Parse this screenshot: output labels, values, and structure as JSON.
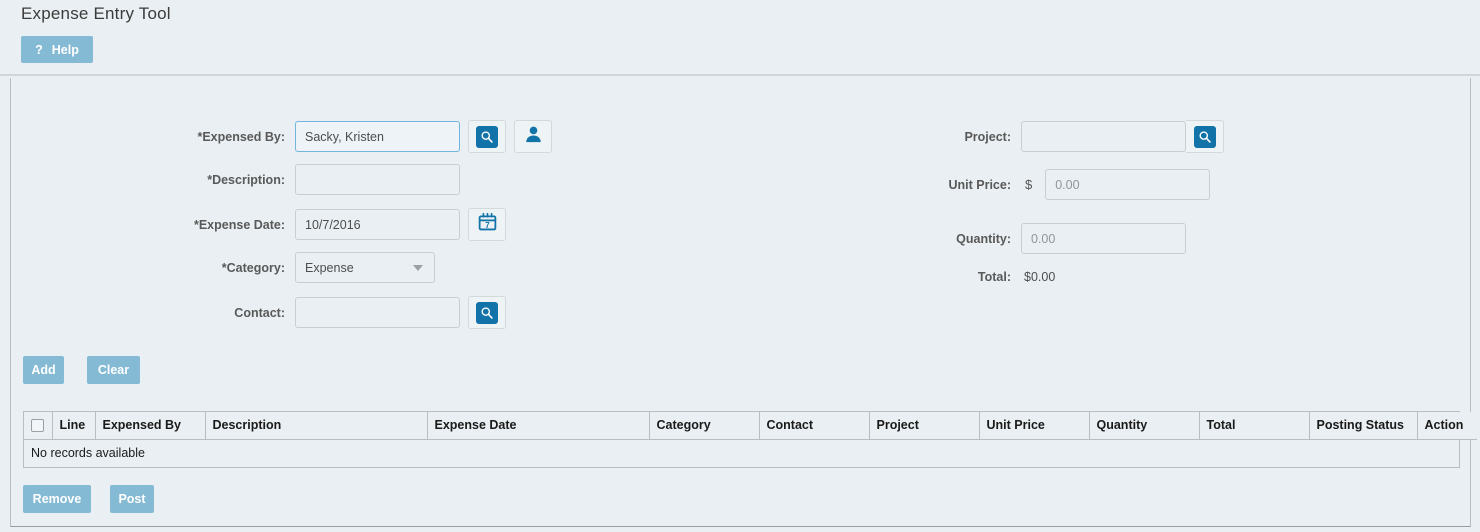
{
  "header": {
    "title": "Expense Entry Tool",
    "help_button": {
      "icon": "question-mark-icon",
      "symbol": "?",
      "label": "Help"
    }
  },
  "form": {
    "left": [
      {
        "label": "*Expensed By:",
        "value": "Sacky, Kristen",
        "placeholder": "",
        "type": "text",
        "focused": true,
        "buttons": [
          {
            "icon": "search-icon",
            "boxed": true
          },
          {
            "icon": "person-icon",
            "boxed": false
          }
        ]
      },
      {
        "label": "*Description:",
        "value": "",
        "placeholder": "",
        "type": "text",
        "focused": false,
        "buttons": []
      },
      {
        "label": "*Expense Date:",
        "value": "10/7/2016",
        "placeholder": "",
        "type": "text",
        "focused": false,
        "buttons": [
          {
            "icon": "calendar-icon",
            "boxed": true
          }
        ]
      },
      {
        "label": "*Category:",
        "value": "Expense",
        "type": "select",
        "options": [
          "Expense"
        ]
      },
      {
        "label": "Contact:",
        "value": "",
        "placeholder": "",
        "type": "text",
        "focused": false,
        "buttons": [
          {
            "icon": "search-icon",
            "boxed": true
          }
        ]
      }
    ],
    "right": [
      {
        "label": "Project:",
        "value": "",
        "placeholder": "",
        "type": "text",
        "buttons": [
          {
            "icon": "search-icon",
            "boxed": true
          }
        ]
      },
      {
        "label": "Unit Price:",
        "prefix": "$",
        "value": "0.00",
        "type": "text"
      },
      {
        "label": "Quantity:",
        "value": "0.00",
        "type": "text"
      },
      {
        "label": "Total:",
        "value": "$0.00",
        "type": "static"
      }
    ]
  },
  "actions": {
    "add_label": "Add",
    "clear_label": "Clear",
    "remove_label": "Remove",
    "post_label": "Post"
  },
  "grid": {
    "select_all_checkbox": "",
    "columns": [
      "",
      "Line",
      "Expensed By",
      "Description",
      "Expense Date",
      "Category",
      "Contact",
      "Project",
      "Unit Price",
      "Quantity",
      "Total",
      "Posting Status",
      "Action"
    ],
    "rows": [],
    "empty_message": "No records available"
  },
  "colors": {
    "page_background": "#e9eff2",
    "button_blue": "#85bad4",
    "icon_blue": "#1273a8",
    "focus_border": "#73b6dd",
    "border_gray": "#b9bdc0",
    "label_gray": "#595959"
  }
}
